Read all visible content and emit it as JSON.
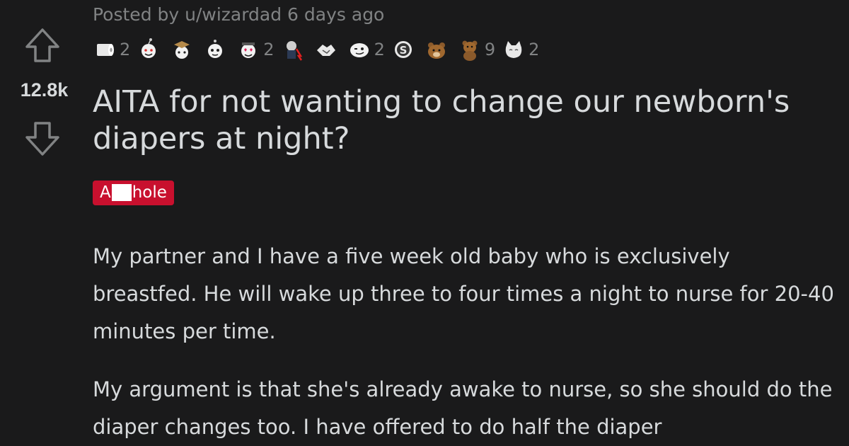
{
  "vote": {
    "score": "12.8k"
  },
  "post": {
    "meta": "Posted by u/wizardad 6 days ago",
    "title": "AITA for not wanting to change our newborn's diapers at night?",
    "flair_start": "A",
    "flair_end": "hole",
    "paragraphs": [
      "My partner and I have a five week old baby who is exclusively breastfed. He will wake up three to four times a night to nurse for 20-40 minutes per time.",
      "My argument is that she's already awake to nurse, so she should do the diaper changes too. I have offered to do half the diaper"
    ]
  },
  "awards": [
    {
      "icon": "toilet-paper-icon",
      "count": "2"
    },
    {
      "icon": "wholesome-icon",
      "count": ""
    },
    {
      "icon": "graduation-snoo-icon",
      "count": ""
    },
    {
      "icon": "silver-snoo-icon",
      "count": ""
    },
    {
      "icon": "heart-eyes-snoo-icon",
      "count": "2"
    },
    {
      "icon": "stonks-falling-icon",
      "count": ""
    },
    {
      "icon": "handshake-icon",
      "count": ""
    },
    {
      "icon": "wink-face-icon",
      "count": "2"
    },
    {
      "icon": "coin-s-icon",
      "count": ""
    },
    {
      "icon": "bear-icon",
      "count": ""
    },
    {
      "icon": "bear-dancing-icon",
      "count": "9"
    },
    {
      "icon": "cat-icon",
      "count": "2"
    }
  ],
  "colors": {
    "background": "#1a1a1b",
    "text": "#d7dadc",
    "muted": "#818384",
    "flair": "#c8102e"
  }
}
